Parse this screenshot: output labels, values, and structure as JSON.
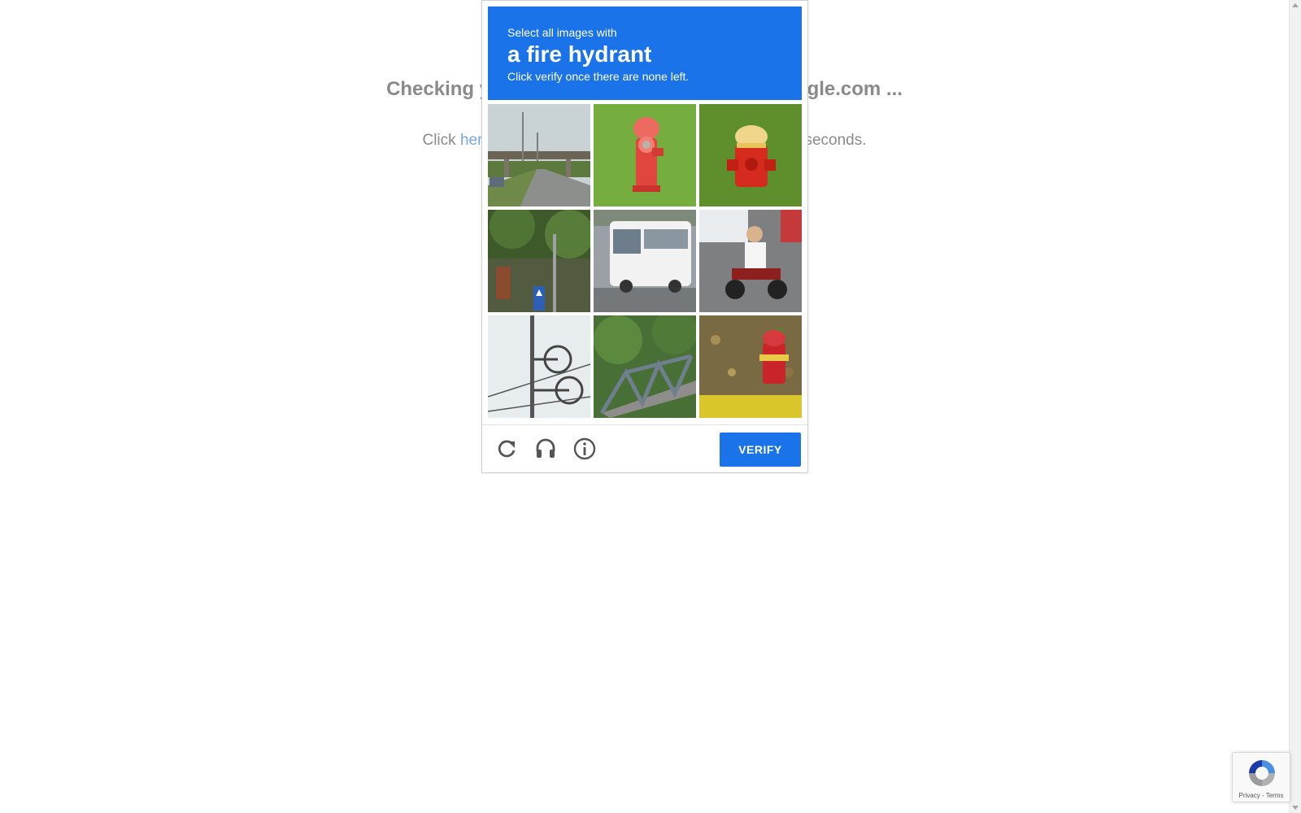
{
  "background": {
    "heading": "Checking your browser before accessing kaggle.com ...",
    "sub_prefix": "Click ",
    "sub_link": "here",
    "sub_suffix": " if you are not automatically redirected after 5 seconds."
  },
  "captcha": {
    "instruction_line1": "Select all images with",
    "target_object": "a fire hydrant",
    "instruction_line3": "Click verify once there are none left.",
    "tiles": [
      {
        "subject": "road-overpass"
      },
      {
        "subject": "fire-hydrant"
      },
      {
        "subject": "fire-hydrant"
      },
      {
        "subject": "fence-trees-sign"
      },
      {
        "subject": "bus"
      },
      {
        "subject": "motorcycle"
      },
      {
        "subject": "power-line-wheels"
      },
      {
        "subject": "bridge-truss"
      },
      {
        "subject": "fire-hydrant"
      }
    ],
    "footer": {
      "reload_icon": "reload-icon",
      "audio_icon": "headphones-icon",
      "info_icon": "info-icon",
      "verify_label": "VERIFY"
    },
    "colors": {
      "banner": "#1a73e8",
      "verify": "#1a73e8"
    }
  },
  "badge": {
    "links": "Privacy - Terms"
  }
}
